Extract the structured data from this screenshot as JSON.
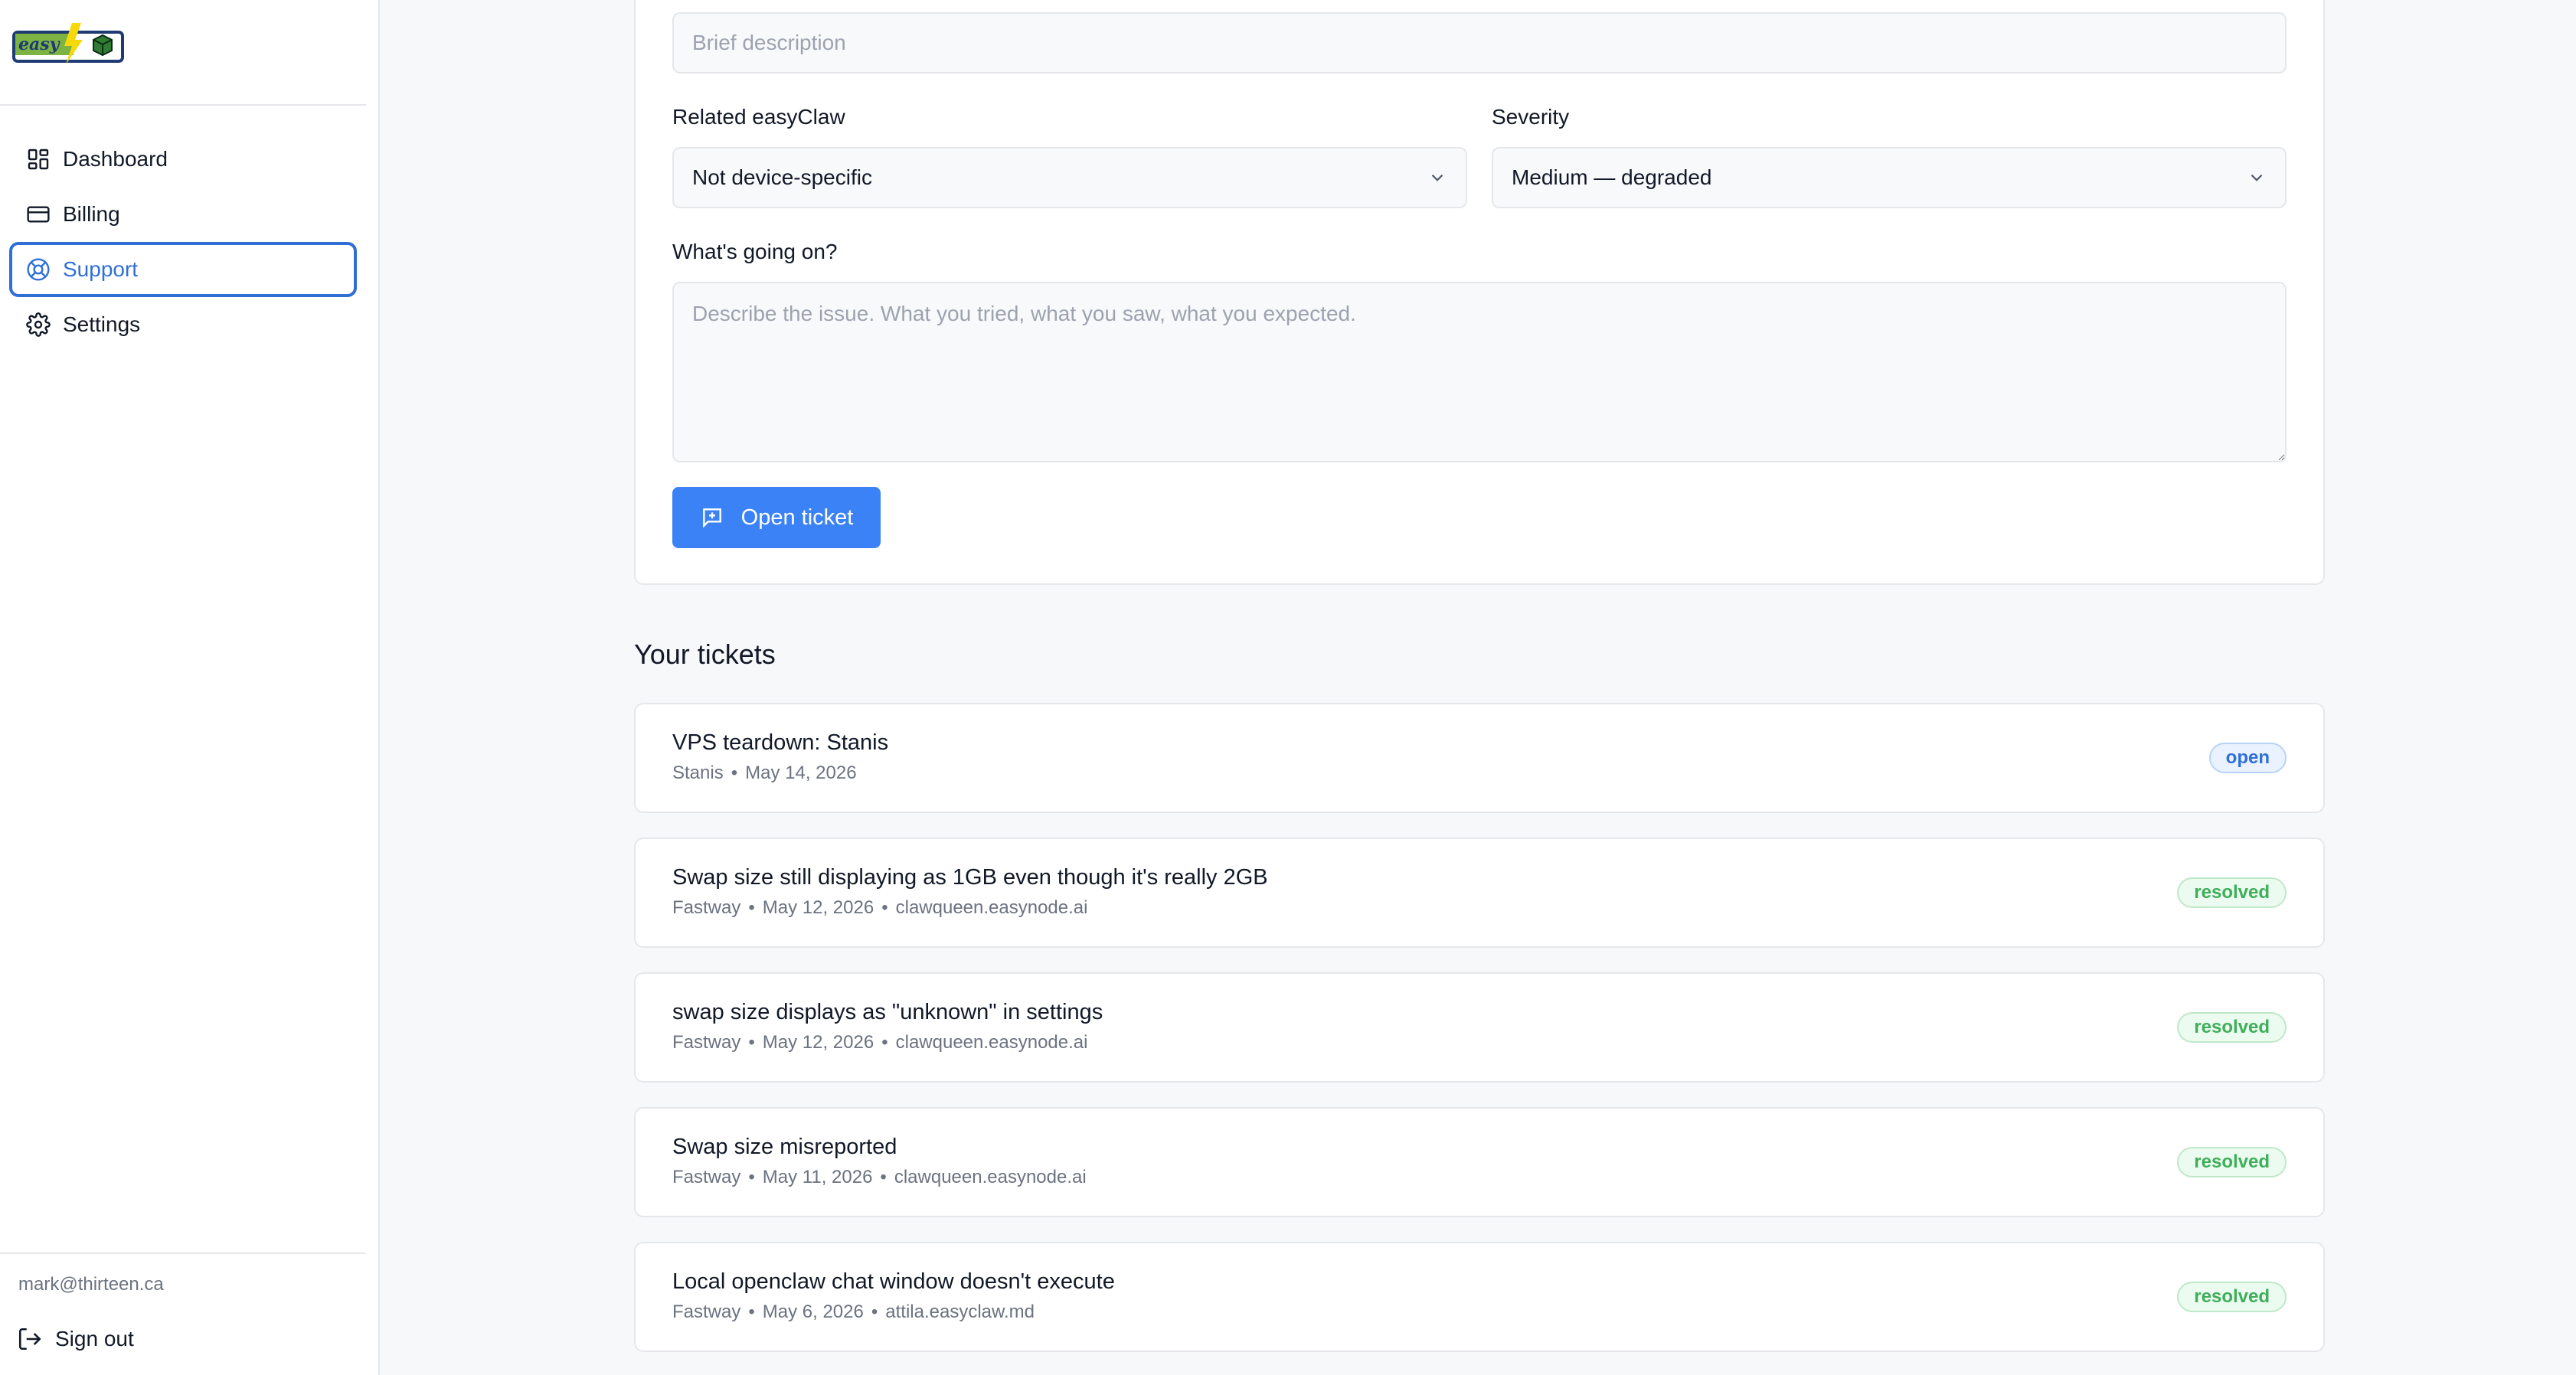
{
  "brand": {
    "logo_text": "easy"
  },
  "sidebar": {
    "items": [
      {
        "label": "Dashboard",
        "icon": "dashboard-grid-icon"
      },
      {
        "label": "Billing",
        "icon": "credit-card-icon"
      },
      {
        "label": "Support",
        "icon": "lifebuoy-icon",
        "active": true
      },
      {
        "label": "Settings",
        "icon": "gear-icon"
      }
    ],
    "user_email": "mark@thirteen.ca",
    "sign_out_label": "Sign out"
  },
  "form": {
    "summary_placeholder": "Brief description",
    "related_label": "Related easyClaw",
    "related_value": "Not device-specific",
    "severity_label": "Severity",
    "severity_value": "Medium — degraded",
    "details_label": "What's going on?",
    "details_placeholder": "Describe the issue. What you tried, what you saw, what you expected.",
    "submit_label": "Open ticket"
  },
  "tickets_section": {
    "title": "Your tickets",
    "tickets": [
      {
        "title": "VPS teardown: Stanis",
        "meta": [
          "Stanis",
          "May 14, 2026"
        ],
        "status": "open"
      },
      {
        "title": "Swap size still displaying as 1GB even though it's really 2GB",
        "meta": [
          "Fastway",
          "May 12, 2026",
          "clawqueen.easynode.ai"
        ],
        "status": "resolved"
      },
      {
        "title": "swap size displays as \"unknown\" in settings",
        "meta": [
          "Fastway",
          "May 12, 2026",
          "clawqueen.easynode.ai"
        ],
        "status": "resolved"
      },
      {
        "title": "Swap size misreported",
        "meta": [
          "Fastway",
          "May 11, 2026",
          "clawqueen.easynode.ai"
        ],
        "status": "resolved"
      },
      {
        "title": "Local openclaw chat window doesn't execute",
        "meta": [
          "Fastway",
          "May 6, 2026",
          "attila.easyclaw.md"
        ],
        "status": "resolved"
      }
    ]
  },
  "colors": {
    "accent": "#3b82f6",
    "active_nav": "#2f6fd6",
    "resolved_green": "#3fae5a"
  }
}
